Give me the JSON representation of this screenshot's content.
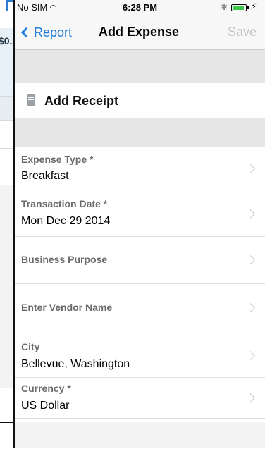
{
  "background": {
    "amount_fragment": "$0."
  },
  "status_bar": {
    "carrier": "No SIM",
    "time": "6:28 PM"
  },
  "nav": {
    "back_label": "Report",
    "title": "Add Expense",
    "save_label": "Save"
  },
  "receipt": {
    "label": "Add Receipt"
  },
  "fields": [
    {
      "label": "Expense Type *",
      "value": "Breakfast"
    },
    {
      "label": "Transaction Date *",
      "value": "Mon Dec 29 2014"
    },
    {
      "label": "Business Purpose",
      "value": ""
    },
    {
      "label": "Enter Vendor Name",
      "value": ""
    },
    {
      "label": "City",
      "value": "Bellevue, Washington"
    },
    {
      "label": "Currency *",
      "value": "US Dollar"
    }
  ],
  "colors": {
    "accent": "#1f7cdb",
    "disabled": "#c3c3c3",
    "section_gray": "#e6e6e6"
  }
}
